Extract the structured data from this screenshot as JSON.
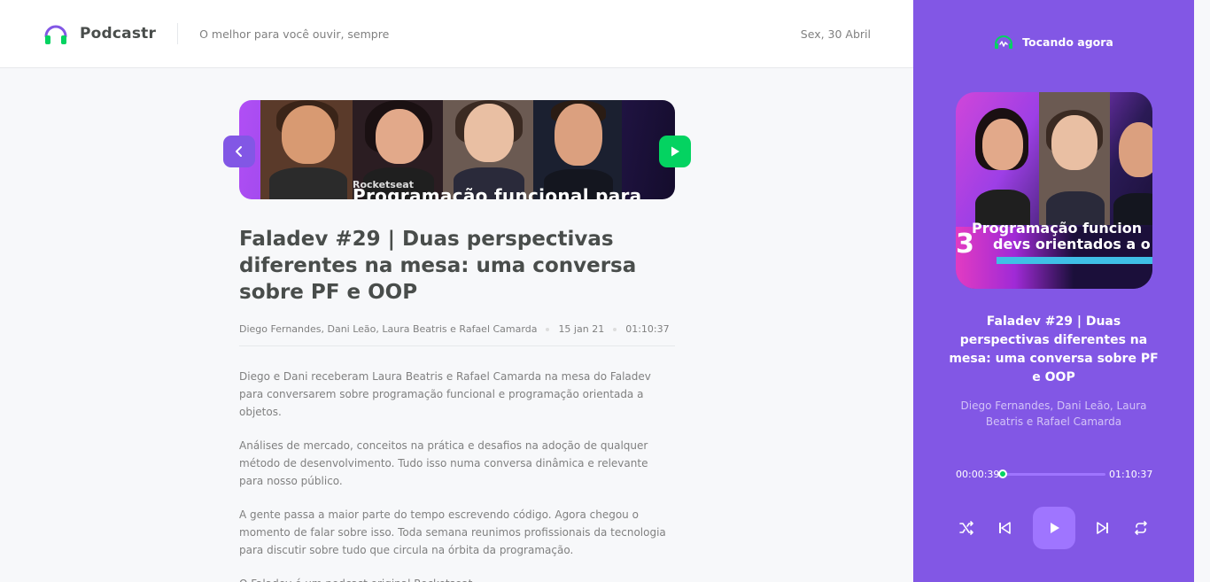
{
  "header": {
    "app_name": "Podcastr",
    "tagline": "O melhor para você ouvir, sempre",
    "date": "Sex, 30 Abril"
  },
  "episode": {
    "thumbnail_caption": "Programação funcional para",
    "thumbnail_badge": "Rocketseat",
    "title": "Faladev #29 | Duas perspectivas diferentes na mesa: uma conversa sobre PF e OOP",
    "members": "Diego Fernandes, Dani Leão, Laura Beatris e Rafael Camarda",
    "published_at": "15 jan 21",
    "duration": "01:10:37",
    "description": [
      "Diego e Dani receberam Laura Beatris e Rafael Camarda na mesa do Faladev para conversarem sobre programação funcional e programação orientada a objetos.",
      "Análises de mercado, conceitos na prática e desafios na adoção de qualquer método de desenvolvimento. Tudo isso numa conversa dinâmica e relevante para nosso público.",
      "A gente passa a maior parte do tempo escrevendo código. Agora chegou o momento de falar sobre isso. Toda semana reunimos profissionais da tecnologia para discutir sobre tudo que circula na órbita da programação.",
      "O Faladev é um podcast original Rocketseat."
    ],
    "back_icon": "chevron-left-icon",
    "play_icon": "play-icon"
  },
  "player": {
    "header_label": "Tocando agora",
    "header_icon": "playing-now-icon",
    "cover_line1": "Programação funcion",
    "cover_line2": "devs orientados a o",
    "cover_number": "3",
    "title": "Faladev #29 | Duas perspectivas diferentes na mesa: uma conversa sobre PF e OOP",
    "members": "Diego Fernandes, Dani Leão, Laura Beatris e Rafael Camarda",
    "current_time": "00:00:39",
    "total_time": "01:10:37",
    "progress_fraction": 0.01,
    "controls": [
      "shuffle-icon",
      "previous-icon",
      "play-icon",
      "next-icon",
      "repeat-icon"
    ]
  },
  "colors": {
    "brand_purple": "#8257e5",
    "accent_green": "#04d361",
    "text_dark": "#494d4b",
    "text_muted": "#808080"
  }
}
